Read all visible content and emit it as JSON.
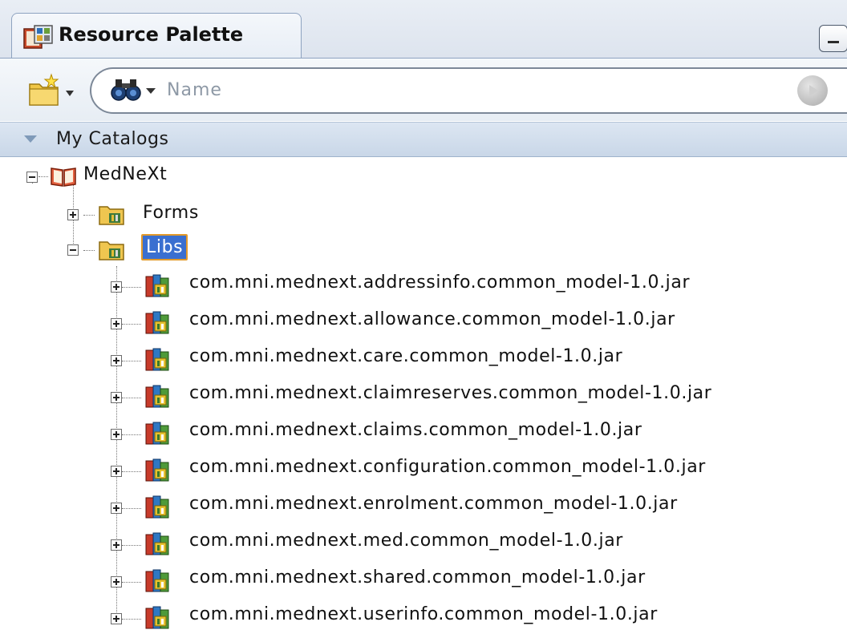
{
  "panel": {
    "title": "Resource Palette"
  },
  "toolbar": {
    "search_placeholder": "Name"
  },
  "catalog_header": {
    "label": "My Catalogs"
  },
  "tree": {
    "root": {
      "label": "MedNeXt",
      "expanded": true
    },
    "folders": [
      {
        "label": "Forms",
        "expanded": false
      },
      {
        "label": "Libs",
        "expanded": true,
        "selected": true
      }
    ],
    "jars": [
      "com.mni.mednext.addressinfo.common_model-1.0.jar",
      "com.mni.mednext.allowance.common_model-1.0.jar",
      "com.mni.mednext.care.common_model-1.0.jar",
      "com.mni.mednext.claimreserves.common_model-1.0.jar",
      "com.mni.mednext.claims.common_model-1.0.jar",
      "com.mni.mednext.configuration.common_model-1.0.jar",
      "com.mni.mednext.enrolment.common_model-1.0.jar",
      "com.mni.mednext.med.common_model-1.0.jar",
      "com.mni.mednext.shared.common_model-1.0.jar",
      "com.mni.mednext.userinfo.common_model-1.0.jar"
    ]
  },
  "icons": {
    "tab": "resource-palette-icon",
    "new": "new-folder-icon",
    "search": "binoculars-icon",
    "go": "go-icon",
    "root": "book-icon",
    "folder": "folder-icon",
    "jar": "jar-icon"
  }
}
